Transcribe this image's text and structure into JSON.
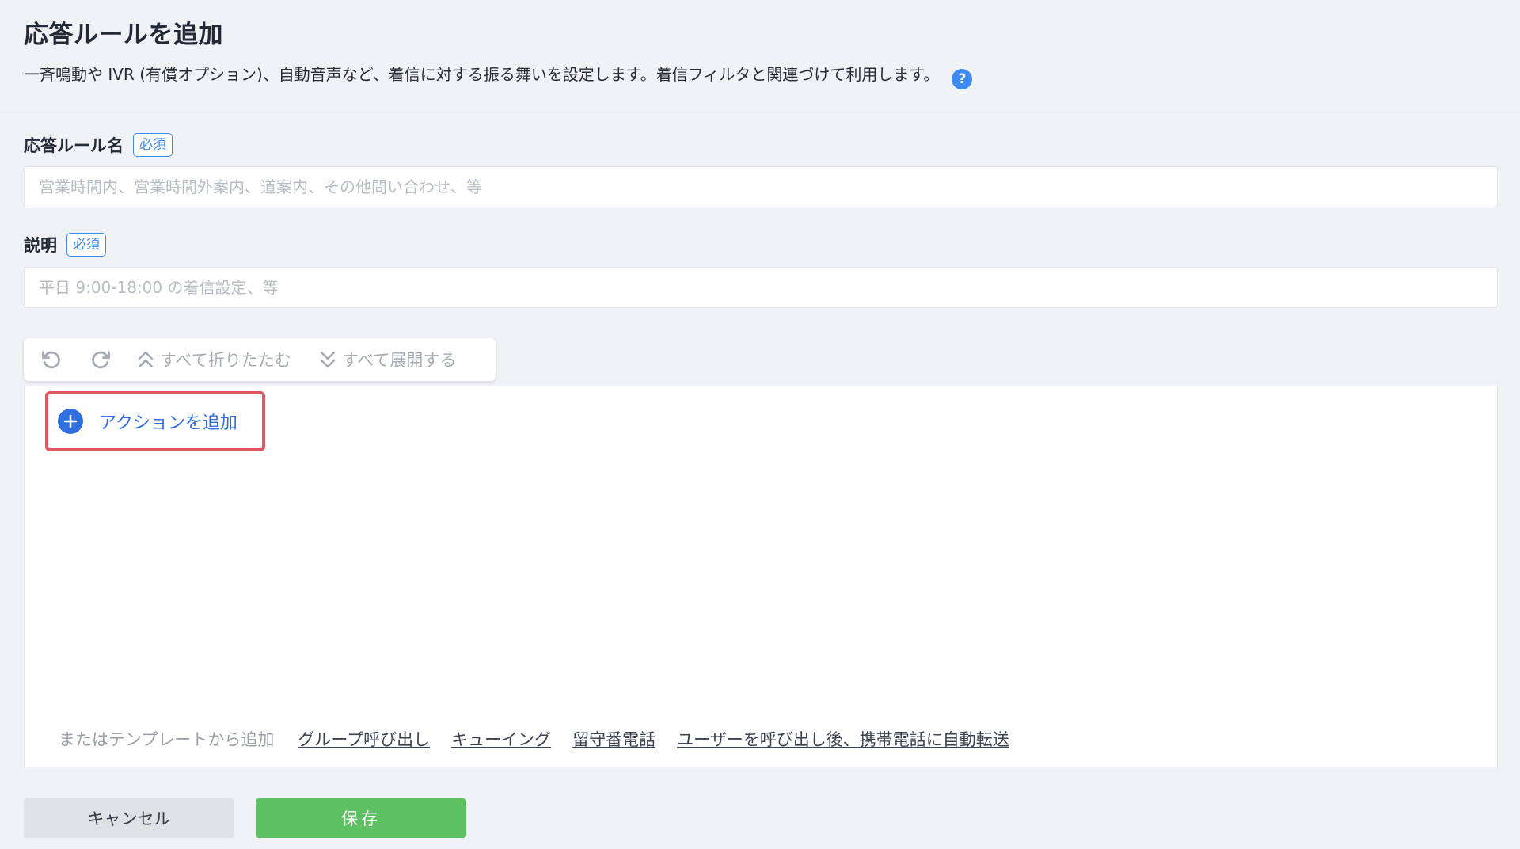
{
  "header": {
    "title": "応答ルールを追加",
    "description": "一斉鳴動や IVR (有償オプション)、自動音声など、着信に対する振る舞いを設定します。着信フィルタと関連づけて利用します。",
    "help_icon": "?"
  },
  "form": {
    "name_label": "応答ルール名",
    "name_required": "必須",
    "name_placeholder": "営業時間内、営業時間外案内、道案内、その他問い合わせ、等",
    "desc_label": "説明",
    "desc_required": "必須",
    "desc_placeholder": "平日 9:00-18:00 の着信設定、等"
  },
  "toolbar": {
    "undo_icon": "undo-icon",
    "redo_icon": "redo-icon",
    "collapse_all": "すべて折りたたむ",
    "expand_all": "すべて展開する"
  },
  "editor": {
    "add_action": "アクションを追加",
    "template_lead": "またはテンプレートから追加",
    "templates": [
      "グループ呼び出し",
      "キューイング",
      "留守番電話",
      "ユーザーを呼び出し後、携帯電話に自動転送"
    ]
  },
  "actions": {
    "cancel": "キャンセル",
    "save": "保存"
  },
  "colors": {
    "accent": "#3d8bf2",
    "highlight_border": "#e65566",
    "save_button": "#5dc062"
  }
}
